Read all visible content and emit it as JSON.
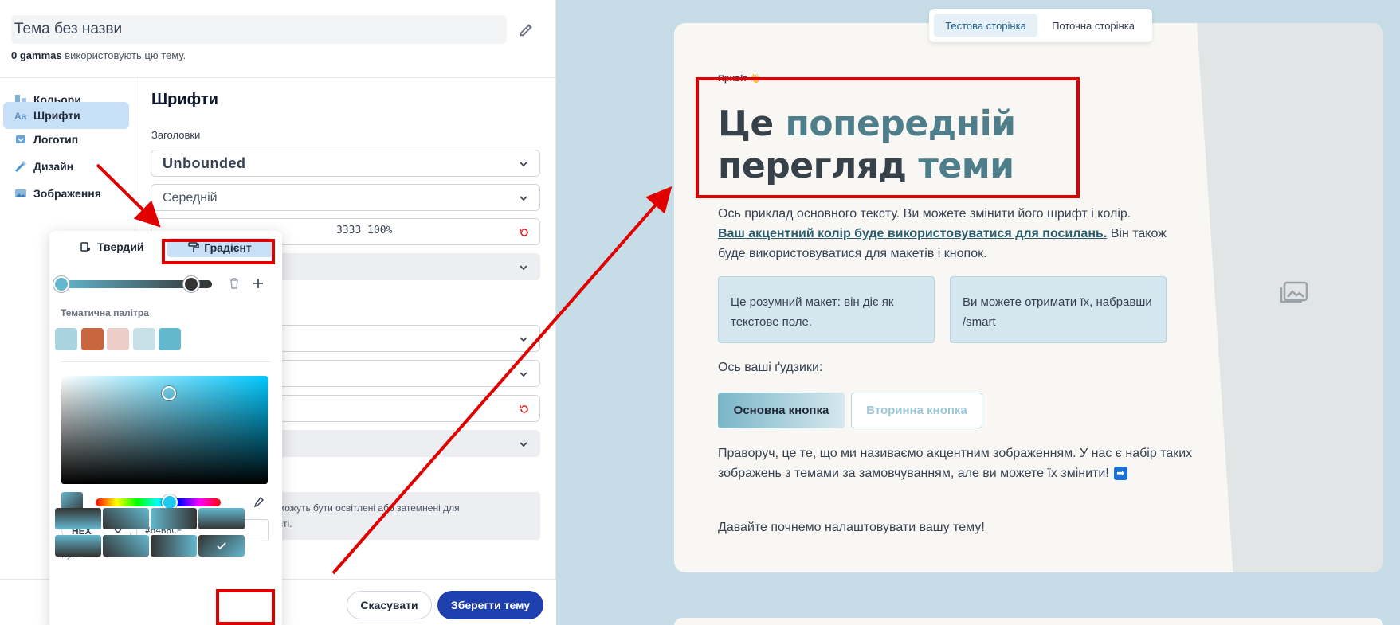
{
  "editor": {
    "theme_name": "Тема без назви",
    "usage_count": "0 gammas",
    "usage_suffix": " використовують цю тему.",
    "nav": [
      "Кольори",
      "Шрифти",
      "Логотип",
      "Дизайн",
      "Зображення"
    ],
    "section_title": "Шрифти",
    "headings_label": "Заголовки",
    "font_family": "Unbounded",
    "font_weight": "Середній",
    "color_value": "3333 100%",
    "note_text": "можуть бути освітлені або затемнені для\nсті.",
    "cancel_label": "Скасувати",
    "save_label": "Зберегти тему"
  },
  "picker": {
    "tab_solid": "Твердий",
    "tab_gradient": "Градієнт",
    "palette_label": "Тематична палітра",
    "palette": [
      "#a9d3df",
      "#c7663f",
      "#ecccc6",
      "#c8e0e8",
      "#64b8ce"
    ],
    "gradient_stops": [
      "#64b8ce",
      "#333333"
    ],
    "mode": "HEX",
    "hex_value": "#64B8CE",
    "angle_label": "Кут.",
    "angle_selected_index": 7
  },
  "preview": {
    "tab_test": "Тестова сторінка",
    "tab_current": "Поточна сторінка",
    "greeting": "Привіт 👋",
    "headline_a1": "Це ",
    "headline_b1": "попередній",
    "headline_a2": "перегляд ",
    "headline_b2": "теми",
    "body_intro": "Ось приклад основного тексту. Ви можете змінити його шрифт і колір.",
    "body_link": "Ваш акцентний колір буде використовуватися для посилань.",
    "body_after_link": " Він також буде використовуватися для макетів і кнопок.",
    "smart_box_1": "Це розумний макет: він діє як текстове поле.",
    "smart_box_2": "Ви можете отримати їх, набравши /smart",
    "gadgets": "Ось ваші ґудзики:",
    "primary_button": "Основна кнопка",
    "secondary_button": "Вторинна кнопка",
    "accent_text": "Праворуч, це те, що ми називаємо акцентним зображенням. У нас є набір таких зображень з темами за замовчуванням, але ви можете їх змінити!",
    "arrow_emoji": "➡",
    "closing": "Давайте почнемо налаштовувати вашу тему!"
  },
  "colors": {
    "accent": "#64b8ce",
    "save_button": "#1e40af",
    "annotation": "#e00000",
    "preview_bg": "#c6dce6"
  }
}
